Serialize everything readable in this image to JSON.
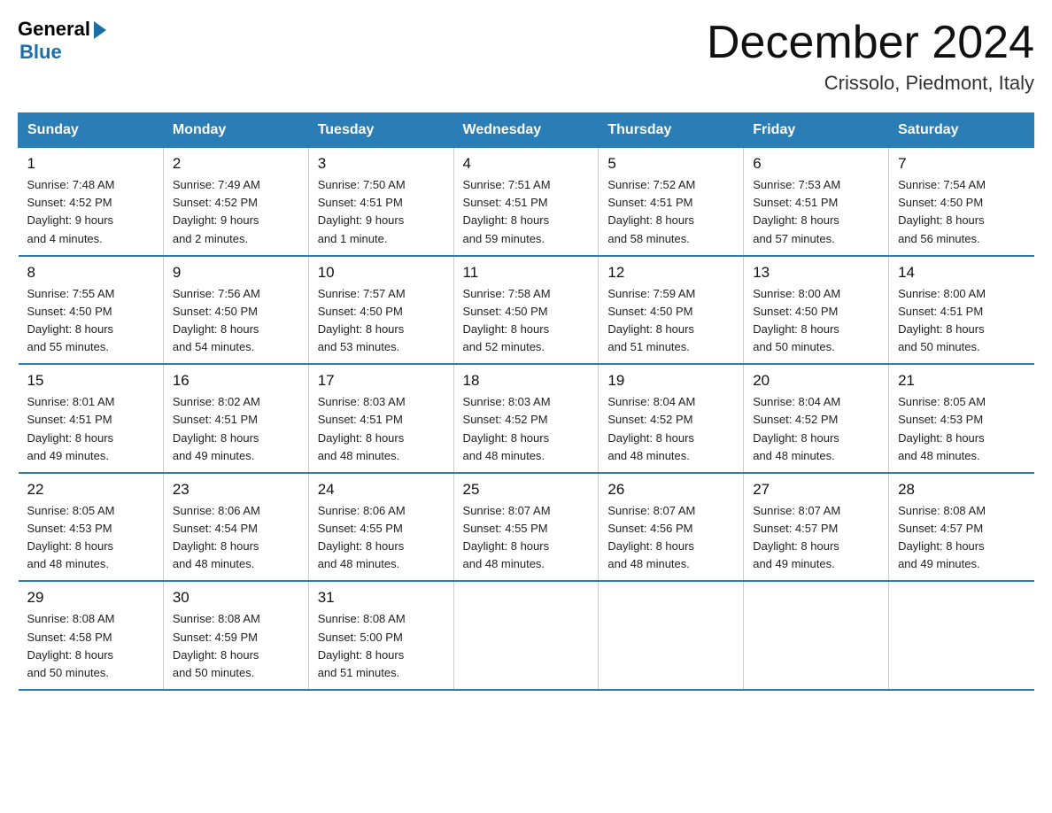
{
  "header": {
    "logo_text": "General",
    "logo_blue": "Blue",
    "month_title": "December 2024",
    "location": "Crissolo, Piedmont, Italy"
  },
  "days_of_week": [
    "Sunday",
    "Monday",
    "Tuesday",
    "Wednesday",
    "Thursday",
    "Friday",
    "Saturday"
  ],
  "weeks": [
    [
      {
        "day": "1",
        "info": "Sunrise: 7:48 AM\nSunset: 4:52 PM\nDaylight: 9 hours\nand 4 minutes."
      },
      {
        "day": "2",
        "info": "Sunrise: 7:49 AM\nSunset: 4:52 PM\nDaylight: 9 hours\nand 2 minutes."
      },
      {
        "day": "3",
        "info": "Sunrise: 7:50 AM\nSunset: 4:51 PM\nDaylight: 9 hours\nand 1 minute."
      },
      {
        "day": "4",
        "info": "Sunrise: 7:51 AM\nSunset: 4:51 PM\nDaylight: 8 hours\nand 59 minutes."
      },
      {
        "day": "5",
        "info": "Sunrise: 7:52 AM\nSunset: 4:51 PM\nDaylight: 8 hours\nand 58 minutes."
      },
      {
        "day": "6",
        "info": "Sunrise: 7:53 AM\nSunset: 4:51 PM\nDaylight: 8 hours\nand 57 minutes."
      },
      {
        "day": "7",
        "info": "Sunrise: 7:54 AM\nSunset: 4:50 PM\nDaylight: 8 hours\nand 56 minutes."
      }
    ],
    [
      {
        "day": "8",
        "info": "Sunrise: 7:55 AM\nSunset: 4:50 PM\nDaylight: 8 hours\nand 55 minutes."
      },
      {
        "day": "9",
        "info": "Sunrise: 7:56 AM\nSunset: 4:50 PM\nDaylight: 8 hours\nand 54 minutes."
      },
      {
        "day": "10",
        "info": "Sunrise: 7:57 AM\nSunset: 4:50 PM\nDaylight: 8 hours\nand 53 minutes."
      },
      {
        "day": "11",
        "info": "Sunrise: 7:58 AM\nSunset: 4:50 PM\nDaylight: 8 hours\nand 52 minutes."
      },
      {
        "day": "12",
        "info": "Sunrise: 7:59 AM\nSunset: 4:50 PM\nDaylight: 8 hours\nand 51 minutes."
      },
      {
        "day": "13",
        "info": "Sunrise: 8:00 AM\nSunset: 4:50 PM\nDaylight: 8 hours\nand 50 minutes."
      },
      {
        "day": "14",
        "info": "Sunrise: 8:00 AM\nSunset: 4:51 PM\nDaylight: 8 hours\nand 50 minutes."
      }
    ],
    [
      {
        "day": "15",
        "info": "Sunrise: 8:01 AM\nSunset: 4:51 PM\nDaylight: 8 hours\nand 49 minutes."
      },
      {
        "day": "16",
        "info": "Sunrise: 8:02 AM\nSunset: 4:51 PM\nDaylight: 8 hours\nand 49 minutes."
      },
      {
        "day": "17",
        "info": "Sunrise: 8:03 AM\nSunset: 4:51 PM\nDaylight: 8 hours\nand 48 minutes."
      },
      {
        "day": "18",
        "info": "Sunrise: 8:03 AM\nSunset: 4:52 PM\nDaylight: 8 hours\nand 48 minutes."
      },
      {
        "day": "19",
        "info": "Sunrise: 8:04 AM\nSunset: 4:52 PM\nDaylight: 8 hours\nand 48 minutes."
      },
      {
        "day": "20",
        "info": "Sunrise: 8:04 AM\nSunset: 4:52 PM\nDaylight: 8 hours\nand 48 minutes."
      },
      {
        "day": "21",
        "info": "Sunrise: 8:05 AM\nSunset: 4:53 PM\nDaylight: 8 hours\nand 48 minutes."
      }
    ],
    [
      {
        "day": "22",
        "info": "Sunrise: 8:05 AM\nSunset: 4:53 PM\nDaylight: 8 hours\nand 48 minutes."
      },
      {
        "day": "23",
        "info": "Sunrise: 8:06 AM\nSunset: 4:54 PM\nDaylight: 8 hours\nand 48 minutes."
      },
      {
        "day": "24",
        "info": "Sunrise: 8:06 AM\nSunset: 4:55 PM\nDaylight: 8 hours\nand 48 minutes."
      },
      {
        "day": "25",
        "info": "Sunrise: 8:07 AM\nSunset: 4:55 PM\nDaylight: 8 hours\nand 48 minutes."
      },
      {
        "day": "26",
        "info": "Sunrise: 8:07 AM\nSunset: 4:56 PM\nDaylight: 8 hours\nand 48 minutes."
      },
      {
        "day": "27",
        "info": "Sunrise: 8:07 AM\nSunset: 4:57 PM\nDaylight: 8 hours\nand 49 minutes."
      },
      {
        "day": "28",
        "info": "Sunrise: 8:08 AM\nSunset: 4:57 PM\nDaylight: 8 hours\nand 49 minutes."
      }
    ],
    [
      {
        "day": "29",
        "info": "Sunrise: 8:08 AM\nSunset: 4:58 PM\nDaylight: 8 hours\nand 50 minutes."
      },
      {
        "day": "30",
        "info": "Sunrise: 8:08 AM\nSunset: 4:59 PM\nDaylight: 8 hours\nand 50 minutes."
      },
      {
        "day": "31",
        "info": "Sunrise: 8:08 AM\nSunset: 5:00 PM\nDaylight: 8 hours\nand 51 minutes."
      },
      {
        "day": "",
        "info": ""
      },
      {
        "day": "",
        "info": ""
      },
      {
        "day": "",
        "info": ""
      },
      {
        "day": "",
        "info": ""
      }
    ]
  ]
}
